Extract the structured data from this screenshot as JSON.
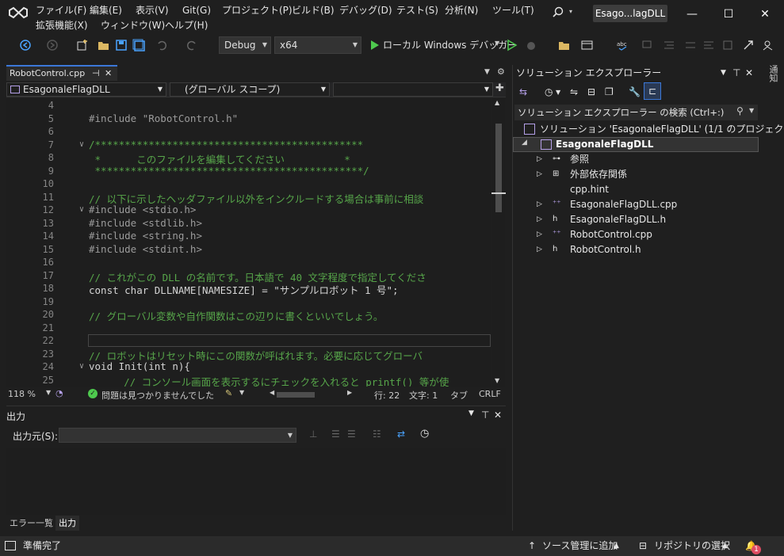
{
  "title_bar": {
    "menus_row1": [
      "ファイル(F)",
      "編集(E)",
      "表示(V)",
      "Git(G)",
      "プロジェクト(P)",
      "ビルド(B)",
      "デバッグ(D)",
      "テスト(S)",
      "分析(N)",
      "ツール(T)"
    ],
    "menus_row2": [
      "拡張機能(X)",
      "ウィンドウ(W)",
      "ヘルプ(H)"
    ],
    "solution_name": "Esago...lagDLL",
    "window_controls": {
      "minimize": "—",
      "maximize": "☐",
      "close": "✕"
    }
  },
  "toolbar": {
    "configuration": "Debug",
    "platform": "x64",
    "run_label": "ローカル Windows デバッガー"
  },
  "editor": {
    "tab_label": "RobotControl.cpp",
    "tab_pin": "⊣",
    "tab_close": "✕",
    "nav_project": "EsagonaleFlagDLL",
    "nav_scope": "(グローバル スコープ)",
    "lines": [
      {
        "n": "4",
        "text": ""
      },
      {
        "n": "5",
        "text": "#include \"RobotControl.h\""
      },
      {
        "n": "6",
        "text": ""
      },
      {
        "n": "7",
        "text": "/*********************************************"
      },
      {
        "n": "8",
        "text": " *      このファイルを編集してください          *"
      },
      {
        "n": "9",
        "text": " *********************************************/"
      },
      {
        "n": "10",
        "text": ""
      },
      {
        "n": "11",
        "text": "// 以下に示したヘッダファイル以外をインクルードする場合は事前に相談"
      },
      {
        "n": "12",
        "text": "#include <stdio.h>"
      },
      {
        "n": "13",
        "text": "#include <stdlib.h>"
      },
      {
        "n": "14",
        "text": "#include <string.h>"
      },
      {
        "n": "15",
        "text": "#include <stdint.h>"
      },
      {
        "n": "16",
        "text": ""
      },
      {
        "n": "17",
        "text": "// これがこの DLL の名前です。日本語で 40 文字程度で指定してくださ"
      },
      {
        "n": "18",
        "text": "const char DLLNAME[NAMESIZE] = \"サンプルロボット 1 号\";"
      },
      {
        "n": "19",
        "text": ""
      },
      {
        "n": "20",
        "text": "// グローバル変数や自作関数はこの辺りに書くといいでしょう。"
      },
      {
        "n": "21",
        "text": ""
      },
      {
        "n": "22",
        "text": ""
      },
      {
        "n": "23",
        "text": "// ロボットはリセット時にこの関数が呼ばれます。必要に応じてグローバ"
      },
      {
        "n": "24",
        "text": "void Init(int n){"
      },
      {
        "n": "25",
        "text": "    // コンソール画面を表示するにチェックを入れると printf() 等が使"
      }
    ],
    "status": {
      "zoom": "118 %",
      "issues": "問題は見つかりませんでした",
      "line": "行: 22",
      "char": "文字: 1",
      "tab": "タブ",
      "eol": "CRLF"
    }
  },
  "output_pane": {
    "title": "出力",
    "source_label": "出力元(S):",
    "source_value": "",
    "tabs": [
      "エラー一覧",
      "出力"
    ]
  },
  "solution_explorer": {
    "title": "ソリューション エクスプローラー",
    "search_placeholder": "ソリューション エクスプローラー の検索 (Ctrl+:)",
    "solution_line": "ソリューション 'EsagonaleFlagDLL' (1/1 のプロジェクト)",
    "project": "EsagonaleFlagDLL",
    "items": [
      "参照",
      "外部依存関係",
      "cpp.hint",
      "EsagonaleFlagDLL.cpp",
      "EsagonaleFlagDLL.h",
      "RobotControl.cpp",
      "RobotControl.h"
    ]
  },
  "right_strip": "通知",
  "status_bar": {
    "ready": "準備完了",
    "source_control": "ソース管理に追加",
    "repo": "リポジトリの選択",
    "notifications": "1"
  }
}
